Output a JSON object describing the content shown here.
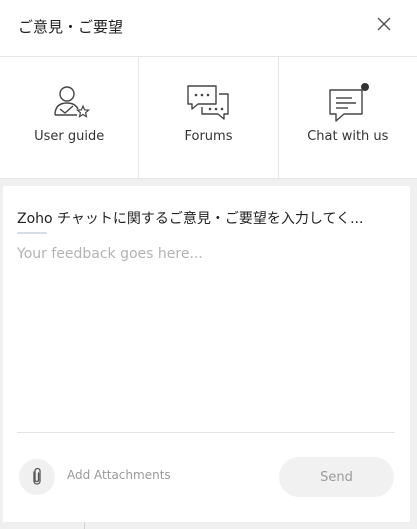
{
  "header": {
    "title": "ご意見・ご要望",
    "close_icon": "close-icon"
  },
  "options": [
    {
      "label": "User guide",
      "icon": "user-guide-icon"
    },
    {
      "label": "Forums",
      "icon": "forums-icon"
    },
    {
      "label": "Chat with us",
      "icon": "chat-icon"
    }
  ],
  "feedback": {
    "subject": "Zoho チャットに関するご意見・ご要望を入力してく...",
    "placeholder": "Your feedback goes here...",
    "value": "",
    "attach_label": "Add Attachments",
    "attach_icon": "paperclip-icon",
    "send_label": "Send"
  },
  "colors": {
    "accent": "#222222",
    "muted": "#9a9a9a",
    "online_dot": "#333333"
  }
}
